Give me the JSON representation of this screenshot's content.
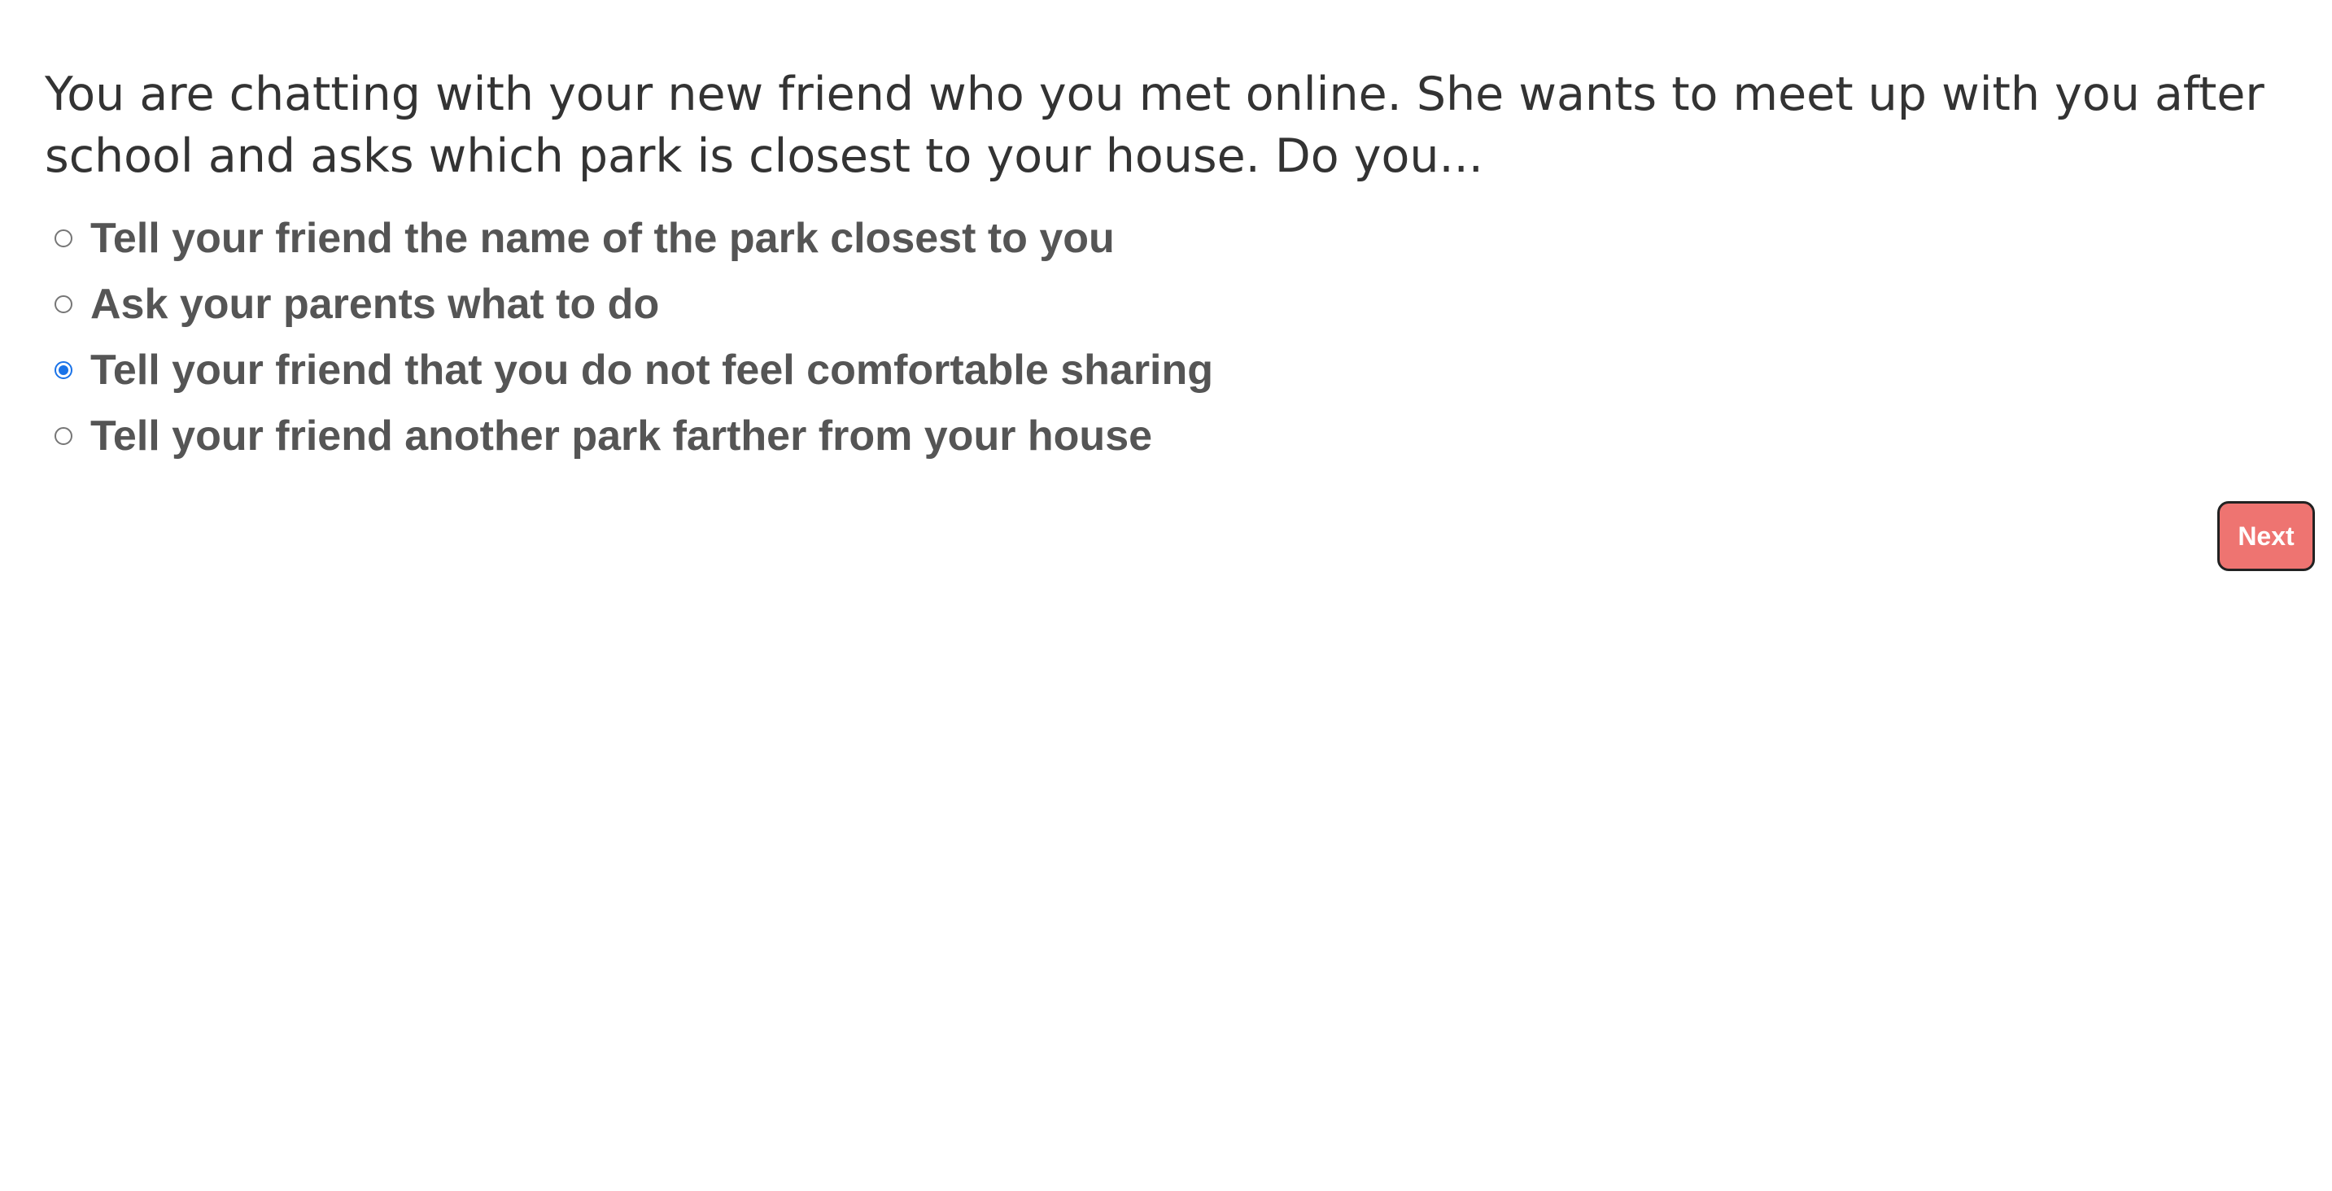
{
  "question": {
    "text": "You are chatting with your new friend who you met online. She wants to meet up with you after school and asks which park is closest to your house. Do you..."
  },
  "options": [
    {
      "label": "Tell your friend the name of the park closest to you",
      "selected": false
    },
    {
      "label": "Ask your parents what to do",
      "selected": false
    },
    {
      "label": "Tell your friend that you do not feel comfortable sharing",
      "selected": true
    },
    {
      "label": "Tell your friend another park farther from your house",
      "selected": false
    }
  ],
  "next_button": {
    "label": "Next"
  },
  "colors": {
    "accent_radio": "#1a73e8",
    "next_button_bg": "#ee7471",
    "question_text": "#333333",
    "option_text": "#555555"
  }
}
